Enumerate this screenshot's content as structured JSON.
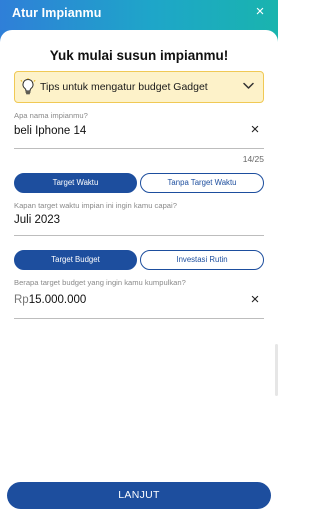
{
  "header": {
    "title": "Atur Impianmu",
    "close_label": "×"
  },
  "main": {
    "heading": "Yuk mulai susun impianmu!",
    "tips": {
      "label": "Tips untuk mengatur budget Gadget",
      "icon": "lightbulb-icon"
    },
    "name_field": {
      "label": "Apa nama impianmu?",
      "value": "beli Iphone 14",
      "counter": "14/25"
    },
    "time_toggle": {
      "option_a": "Target Waktu",
      "option_b": "Tanpa Target Waktu",
      "selected": "Target Waktu"
    },
    "time_field": {
      "label": "Kapan target waktu impian ini ingin kamu capai?",
      "value": "Juli 2023"
    },
    "budget_toggle": {
      "option_a": "Target Budget",
      "option_b": "Investasi Rutin",
      "selected": "Target Budget"
    },
    "budget_field": {
      "label": "Berapa target budget yang ingin kamu kumpulkan?",
      "prefix": "Rp",
      "value": "15.000.000"
    }
  },
  "footer": {
    "next_label": "LANJUT"
  },
  "colors": {
    "primary": "#1d4e9e",
    "tips_bg": "#fdf2c9",
    "tips_border": "#f0c955",
    "header_start": "#2f7fd8",
    "header_end": "#19b4ae"
  }
}
